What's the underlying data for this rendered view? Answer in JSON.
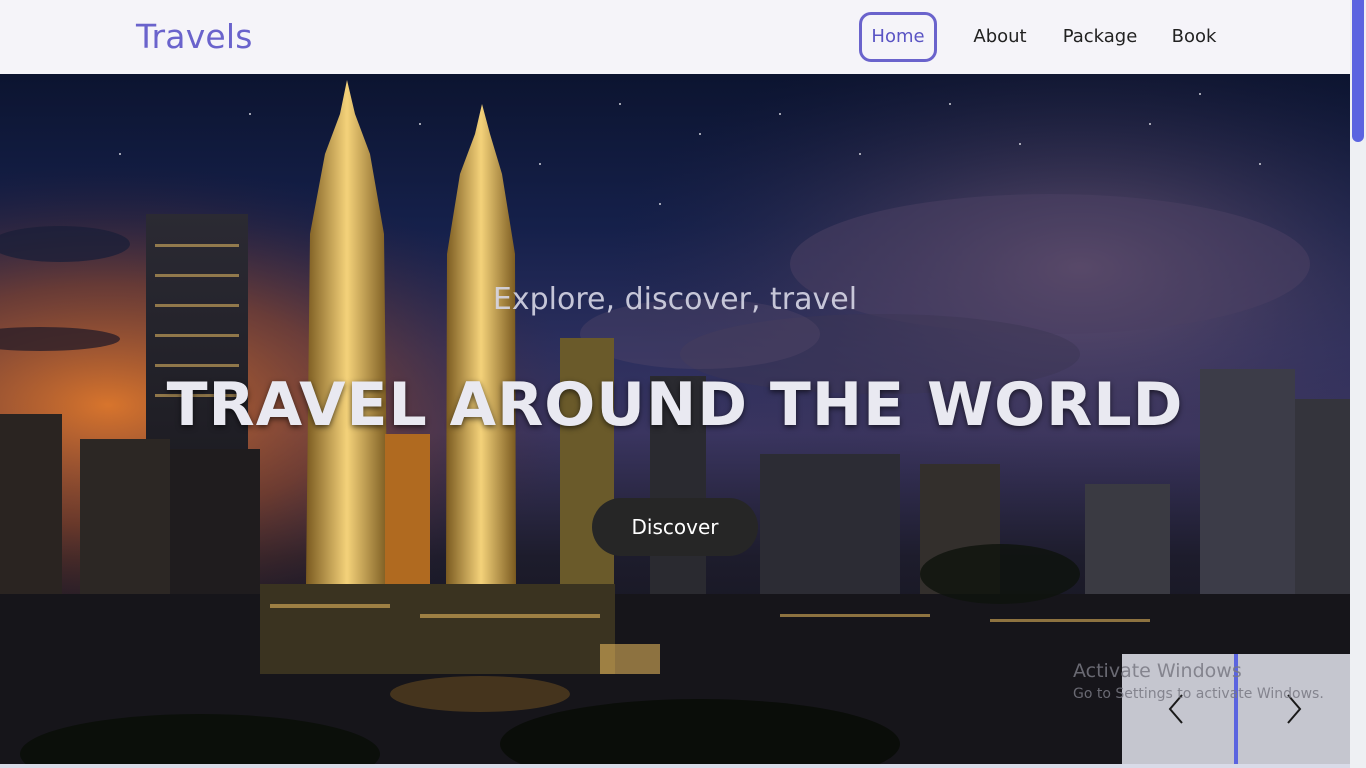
{
  "brand": "Travels",
  "nav": [
    {
      "label": "Home",
      "active": true
    },
    {
      "label": "About",
      "active": false
    },
    {
      "label": "Package",
      "active": false
    },
    {
      "label": "Book",
      "active": false
    }
  ],
  "hero": {
    "subtitle": "Explore, discover, travel",
    "title": "TRAVEL AROUND THE WORLD",
    "cta_label": "Discover"
  },
  "watermark": {
    "title": "Activate Windows",
    "subtitle": "Go to Settings to activate Windows."
  },
  "icons": {
    "prev": "chevron-left-icon",
    "next": "chevron-right-icon"
  },
  "colors": {
    "accent": "#6a63cc",
    "scrollbar": "#5b64e0",
    "button": "#262626"
  }
}
